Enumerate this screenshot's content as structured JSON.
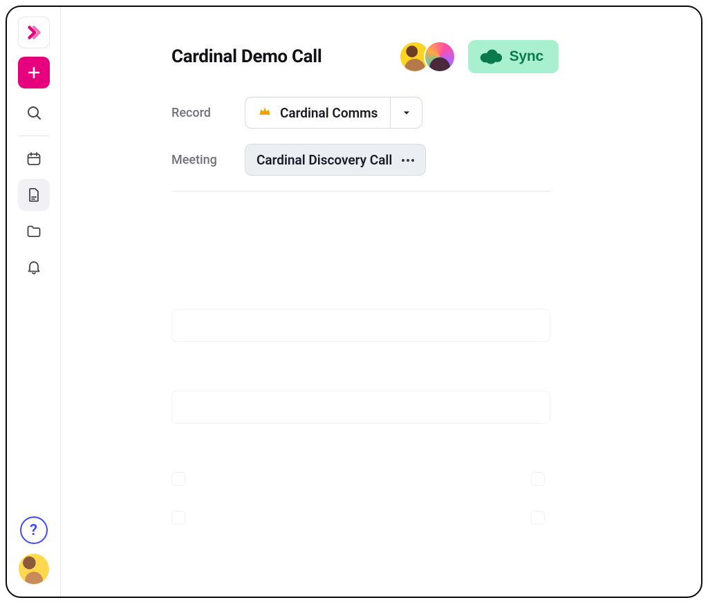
{
  "header": {
    "title": "Cardinal Demo Call",
    "sync_label": "Sync"
  },
  "meta": {
    "record_label": "Record",
    "record_value": "Cardinal Comms",
    "meeting_label": "Meeting",
    "meeting_value": "Cardinal Discovery Call"
  },
  "sidebar": {
    "icons": {
      "logo": "app-logo",
      "add": "add",
      "search": "search",
      "calendar": "calendar",
      "document": "document",
      "folder": "folder",
      "bell": "bell"
    }
  },
  "help_glyph": "?",
  "colors": {
    "brand_pink": "#e6007e",
    "sync_bg": "#a8f0cf",
    "sync_fg": "#0b7a4b",
    "help_blue": "#3b4bff",
    "crown": "#f5a300"
  }
}
